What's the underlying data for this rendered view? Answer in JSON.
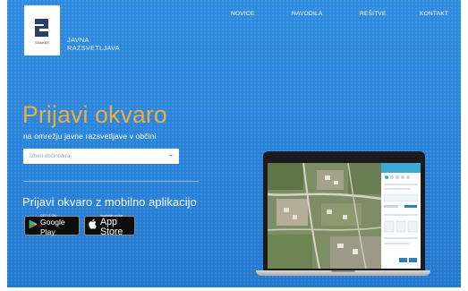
{
  "brand": {
    "logo_caption": "SMAKER",
    "line1": "JAVNA",
    "line2": "RAZSVETLJAVA"
  },
  "nav": {
    "items": [
      "NOVICE",
      "NAVODILA",
      "REŠITVE",
      "KONTAKT"
    ]
  },
  "hero": {
    "title": "Prijavi okvaro",
    "subtitle": "na omrežju javne razsvetljave v občini",
    "select_placeholder": "Izberi občino/kraj",
    "mobile_title": "Prijavi okvaro z mobilno aplikacijo"
  },
  "stores": {
    "google_small": "GET IT ON",
    "google_big": "Google Play",
    "apple_small": "Available on the",
    "apple_big": "App Store"
  },
  "colors": {
    "accent": "#f3ac3a",
    "hero_blue": "#2a84db"
  }
}
